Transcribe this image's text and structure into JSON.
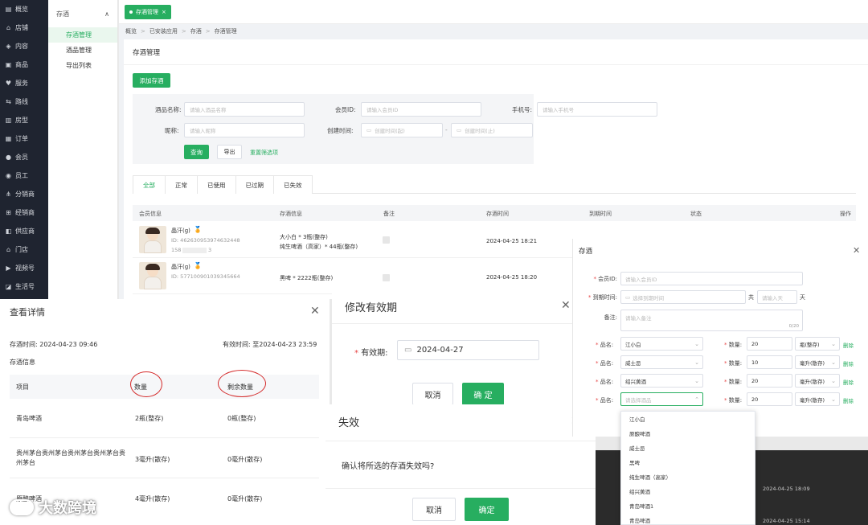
{
  "leftnav": {
    "items": [
      {
        "label": "概览",
        "icon": "dashboard-icon"
      },
      {
        "label": "店铺",
        "icon": "home-icon"
      },
      {
        "label": "内容",
        "icon": "layers-icon"
      },
      {
        "label": "商品",
        "icon": "goods-icon"
      },
      {
        "label": "服务",
        "icon": "heart-icon"
      },
      {
        "label": "路线",
        "icon": "route-icon"
      },
      {
        "label": "房型",
        "icon": "room-icon"
      },
      {
        "label": "订单",
        "icon": "order-icon"
      },
      {
        "label": "会员",
        "icon": "user-icon"
      },
      {
        "label": "员工",
        "icon": "staff-icon"
      },
      {
        "label": "分销商",
        "icon": "share-icon"
      },
      {
        "label": "经销商",
        "icon": "dealer-icon"
      },
      {
        "label": "供应商",
        "icon": "supplier-icon"
      },
      {
        "label": "门店",
        "icon": "store-icon"
      },
      {
        "label": "视频号",
        "icon": "video-icon"
      },
      {
        "label": "生活号",
        "icon": "life-icon"
      }
    ]
  },
  "subnav": {
    "group": "存酒",
    "items": [
      {
        "label": "存酒管理",
        "active": true
      },
      {
        "label": "酒品管理",
        "active": false
      },
      {
        "label": "导出列表",
        "active": false
      }
    ]
  },
  "tabbar": {
    "tab": "存酒管理"
  },
  "breadcrumb": [
    "概览",
    "已安装应用",
    "存酒",
    "存酒管理"
  ],
  "page": {
    "title": "存酒管理",
    "add_button": "添加存酒",
    "filters": {
      "wine_name_label": "酒品名称:",
      "wine_name_placeholder": "请输入酒品名称",
      "member_id_label": "会员ID:",
      "member_id_placeholder": "请输入会员ID",
      "phone_label": "手机号:",
      "phone_placeholder": "请输入手机号",
      "nickname_label": "昵称:",
      "nickname_placeholder": "请输入昵称",
      "created_label": "创建时间:",
      "created_start_placeholder": "创建时间(起)",
      "created_end_placeholder": "创建时间(止)",
      "dash": "-",
      "query": "查询",
      "export": "导出",
      "reset": "重置筛选项"
    },
    "status_tabs": [
      "全部",
      "正常",
      "已使用",
      "已过期",
      "已失效"
    ],
    "table_headers": [
      "会员信息",
      "存酒信息",
      "备注",
      "存酒时间",
      "到期时间",
      "状态",
      "操作"
    ],
    "rows": [
      {
        "name": "晶汗(g)",
        "id": "ID: 462630953974632448",
        "phone": "158",
        "phone_tail": "3",
        "wine1": "大小白 * 3瓶(整存)",
        "wine2": "纯生啤酒（高家）* 44瓶(整存)",
        "time": "2024-04-25 18:21"
      },
      {
        "name": "晶汗(g)",
        "id": "ID: 577100901039345664",
        "wine1": "黑啤 * 2222瓶(整存)",
        "time": "2024-04-25 18:20"
      }
    ]
  },
  "detail_dialog": {
    "title": "查看详情",
    "store_time": "存酒时间: 2024-04-23 09:46",
    "valid_time": "有效时间: 至2024-04-23 23:59",
    "section": "存酒信息",
    "headers": [
      "项目",
      "数量",
      "剩余数量"
    ],
    "rows": [
      {
        "item": "青岛啤酒",
        "qty": "2瓶(整存)",
        "remain": "0瓶(整存)"
      },
      {
        "item": "贵州茅台贵州茅台贵州茅台贵州茅台贵州茅台",
        "qty": "3毫升(散存)",
        "remain": "0毫升(散存)"
      },
      {
        "item": "原酿啤酒",
        "qty": "4毫升(散存)",
        "remain": "0毫升(散存)"
      }
    ]
  },
  "extend_dialog": {
    "title": "修改有效期",
    "label": "有效期:",
    "value": "2024-04-27",
    "cancel": "取消",
    "confirm": "确 定"
  },
  "invalidate_dialog": {
    "title": "失效",
    "message": "确认将所选的存酒失效吗?",
    "cancel": "取消",
    "confirm": "确定"
  },
  "store_dialog": {
    "title": "存酒",
    "member_label": "会员ID:",
    "member_placeholder": "请输入会员ID",
    "expire_label": "到期时间:",
    "expire_placeholder": "选择到期时间",
    "total_label": "共",
    "days_placeholder": "请输入天",
    "days_unit": "天",
    "note_label": "备注:",
    "note_placeholder": "请输入备注",
    "note_counter": "0/20",
    "product_label": "品名:",
    "qty_label": "数量:",
    "delete": "删除",
    "lines": [
      {
        "product": "江小白",
        "qty": "20",
        "unit": "瓶(整存)"
      },
      {
        "product": "威士忌",
        "qty": "10",
        "unit": "毫升(散存)"
      },
      {
        "product": "绍兴黄酒",
        "qty": "20",
        "unit": "毫升(散存)"
      },
      {
        "product": "请选择酒品",
        "qty": "20",
        "unit": "毫升(散存)"
      }
    ]
  },
  "dropdown_options": [
    "江小白",
    "原酿啤酒",
    "威士忌",
    "黑啤",
    "纯生啤酒（高家）",
    "绍兴黄酒",
    "青岛啤酒1",
    "青岛啤酒"
  ],
  "background_strip": {
    "time1": "2024-04-25 18:09",
    "time2": "2024-04-25 15:14"
  },
  "watermark": "大数跨境",
  "colors": {
    "accent": "#27ae60",
    "nav_bg": "#1f2430",
    "danger": "#e64545"
  }
}
